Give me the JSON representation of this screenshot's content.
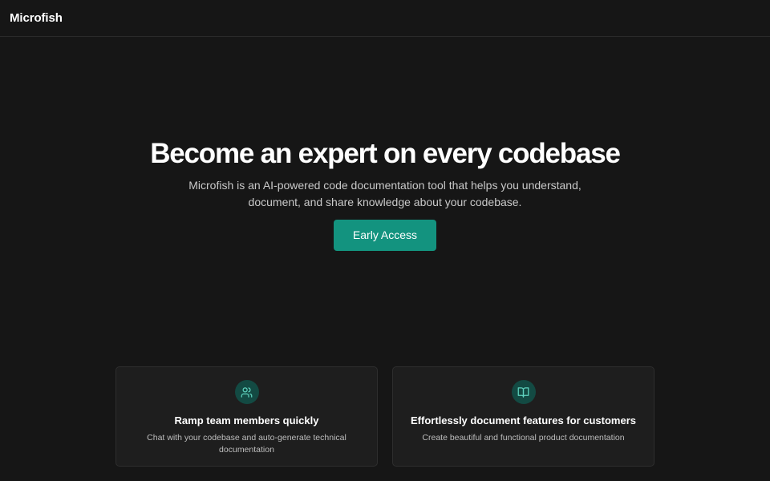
{
  "navbar": {
    "brand": "Microfish"
  },
  "hero": {
    "title": "Become an expert on every codebase",
    "subtitle": "Microfish is an AI-powered code documentation tool that helps you understand, document, and share knowledge about your codebase.",
    "cta_label": "Early Access"
  },
  "features": [
    {
      "icon": "users-icon",
      "title": "Ramp team members quickly",
      "description": "Chat with your codebase and auto-generate technical documentation"
    },
    {
      "icon": "book-open-icon",
      "title": "Effortlessly document features for customers",
      "description": "Create beautiful and functional product documentation"
    }
  ],
  "colors": {
    "background": "#161616",
    "accent": "#13937f",
    "icon_circle": "#134a43",
    "icon_stroke": "#5fd3bf",
    "card_bg": "#1e1e1e"
  }
}
